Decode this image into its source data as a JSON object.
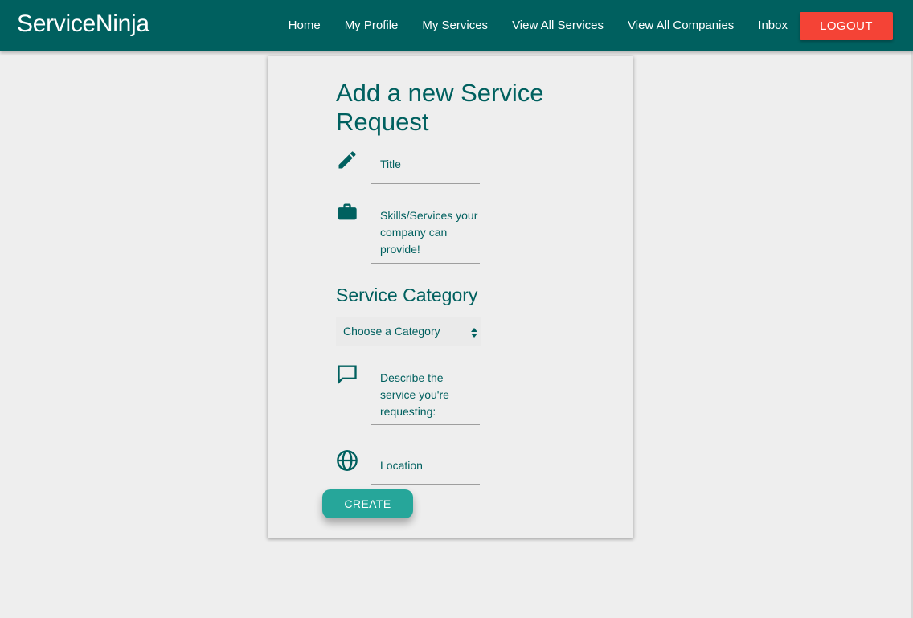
{
  "navbar": {
    "brand": "ServiceNinja",
    "links": [
      {
        "label": "Home"
      },
      {
        "label": "My Profile"
      },
      {
        "label": "My Services"
      },
      {
        "label": "View All Services"
      },
      {
        "label": "View All Companies"
      },
      {
        "label": "Inbox"
      }
    ],
    "logout_label": "LOGOUT"
  },
  "form": {
    "title": "Add a new Service Request",
    "fields": {
      "title": {
        "label": "Title",
        "icon": "pencil-icon"
      },
      "skills": {
        "label": "Skills/Services your company can provide!",
        "icon": "briefcase-icon"
      },
      "description": {
        "label": "Describe the service you're requesting:",
        "icon": "chat-icon"
      },
      "location": {
        "label": "Location",
        "icon": "globe-icon"
      }
    },
    "category": {
      "heading": "Service Category",
      "selected": "Choose a Category"
    },
    "create_label": "CREATE"
  },
  "colors": {
    "primary": "#00605f",
    "accent": "#26a69a",
    "danger": "#f44336",
    "background": "#eeeeee"
  }
}
